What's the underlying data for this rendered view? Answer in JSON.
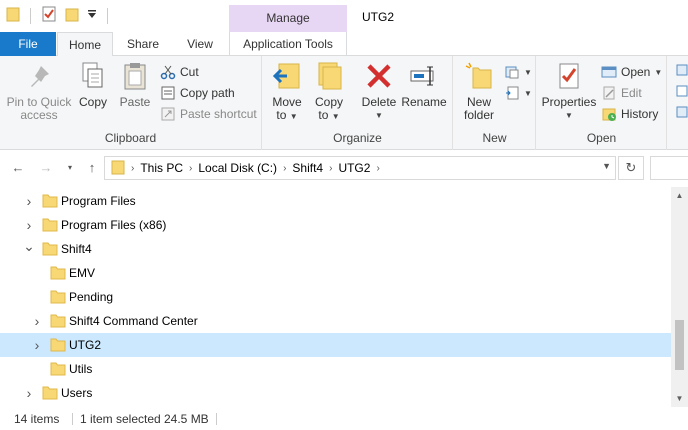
{
  "window": {
    "title": "UTG2"
  },
  "contextual": {
    "header": "Manage",
    "tab": "Application Tools"
  },
  "tabs": {
    "file": "File",
    "home": "Home",
    "share": "Share",
    "view": "View"
  },
  "ribbon": {
    "clipboard": {
      "label": "Clipboard",
      "pin": "Pin to Quick access",
      "copy": "Copy",
      "paste": "Paste",
      "cut": "Cut",
      "copy_path": "Copy path",
      "paste_shortcut": "Paste shortcut"
    },
    "organize": {
      "label": "Organize",
      "move_to": "Move to",
      "copy_to": "Copy to",
      "delete": "Delete",
      "rename": "Rename"
    },
    "new": {
      "label": "New",
      "new_folder": "New folder"
    },
    "open": {
      "label": "Open",
      "properties": "Properties",
      "open": "Open",
      "edit": "Edit",
      "history": "History"
    }
  },
  "address": {
    "crumbs": [
      "This PC",
      "Local Disk (C:)",
      "Shift4",
      "UTG2"
    ]
  },
  "tree": [
    {
      "label": "Program Files",
      "expander": "collapsed",
      "indent": 0
    },
    {
      "label": "Program Files (x86)",
      "expander": "collapsed",
      "indent": 0
    },
    {
      "label": "Shift4",
      "expander": "expanded",
      "indent": 0
    },
    {
      "label": "EMV",
      "expander": "none",
      "indent": 1
    },
    {
      "label": "Pending",
      "expander": "none",
      "indent": 1
    },
    {
      "label": "Shift4 Command Center",
      "expander": "collapsed",
      "indent": 1
    },
    {
      "label": "UTG2",
      "expander": "collapsed",
      "indent": 1,
      "selected": true
    },
    {
      "label": "Utils",
      "expander": "none",
      "indent": 1
    },
    {
      "label": "Users",
      "expander": "collapsed",
      "indent": 0
    }
  ],
  "status": {
    "items": "14 items",
    "selected": "1 item selected",
    "size": "24.5 MB"
  },
  "colors": {
    "accent": "#1979ca",
    "selection": "#cce8ff",
    "folder": "#f8d775",
    "contextual": "#e8d6f5"
  }
}
